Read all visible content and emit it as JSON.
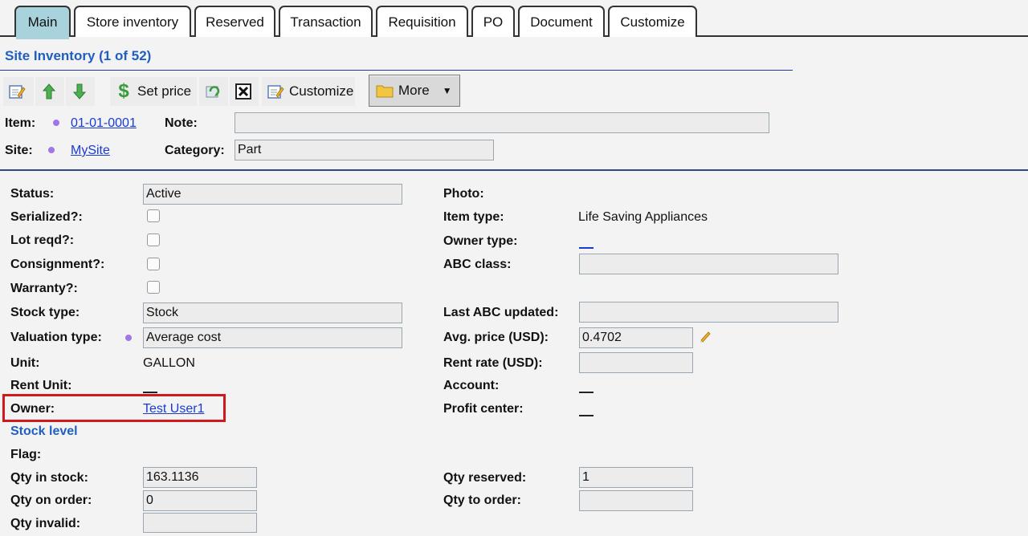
{
  "tabs": [
    {
      "label": "Main",
      "active": true
    },
    {
      "label": "Store inventory"
    },
    {
      "label": "Reserved"
    },
    {
      "label": "Transaction"
    },
    {
      "label": "Requisition"
    },
    {
      "label": "PO"
    },
    {
      "label": "Document"
    },
    {
      "label": "Customize"
    }
  ],
  "header": {
    "title": "Site Inventory (1 of 52)"
  },
  "toolbar": {
    "set_price_label": "Set price",
    "customize_label": "Customize",
    "more_label": "More"
  },
  "record": {
    "item_label": "Item:",
    "item_value": "01-01-0001",
    "note_label": "Note:",
    "note_value": "",
    "site_label": "Site:",
    "site_value": "MySite",
    "category_label": "Category:",
    "category_value": "Part"
  },
  "left": {
    "status_label": "Status:",
    "status_value": "Active",
    "serialized_label": "Serialized?:",
    "lot_label": "Lot reqd?:",
    "consignment_label": "Consignment?:",
    "warranty_label": "Warranty?:",
    "stock_type_label": "Stock type:",
    "stock_type_value": "Stock",
    "valuation_label": "Valuation type:",
    "valuation_value": "Average cost",
    "unit_label": "Unit:",
    "unit_value": "GALLON",
    "rent_unit_label": "Rent Unit:",
    "owner_label": "Owner:",
    "owner_value": "Test User1"
  },
  "right": {
    "photo_label": "Photo:",
    "item_type_label": "Item type:",
    "item_type_value": "Life Saving Appliances",
    "owner_type_label": "Owner type:",
    "abc_class_label": "ABC class:",
    "abc_class_value": "",
    "last_abc_label": "Last ABC updated:",
    "last_abc_value": "",
    "avg_price_label": "Avg. price (USD):",
    "avg_price_value": "0.4702",
    "rent_rate_label": "Rent rate (USD):",
    "rent_rate_value": "",
    "account_label": "Account:",
    "profit_center_label": "Profit center:"
  },
  "stock": {
    "section_label": "Stock level",
    "flag_label": "Flag:",
    "qty_in_stock_label": "Qty in stock:",
    "qty_in_stock_value": "163.1136",
    "qty_on_order_label": "Qty on order:",
    "qty_on_order_value": "0",
    "qty_invalid_label": "Qty invalid:",
    "qty_invalid_value": "",
    "qty_reserved_label": "Qty reserved:",
    "qty_reserved_value": "1",
    "qty_to_order_label": "Qty to order:",
    "qty_to_order_value": ""
  },
  "colors": {
    "accent": "#1f5fbf",
    "active_tab": "#a9d3dc",
    "highlight": "#d0191c",
    "link": "#1a3ad6"
  }
}
